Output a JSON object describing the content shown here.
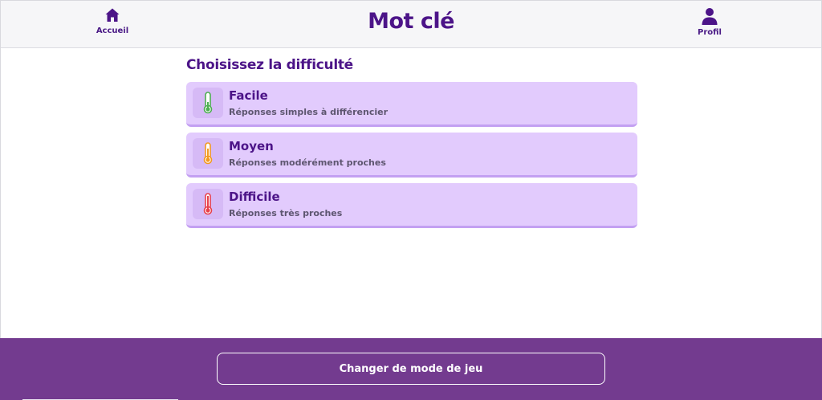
{
  "header": {
    "title": "Mot clé",
    "home_label": "Accueil",
    "profile_label": "Profil"
  },
  "main": {
    "section_title": "Choisissez la difficulté",
    "levels": [
      {
        "name": "Facile",
        "description": "Réponses simples à différencier",
        "icon": "thermometer-low-icon",
        "color": "#4caf50"
      },
      {
        "name": "Moyen",
        "description": "Réponses modérément proches",
        "icon": "thermometer-medium-icon",
        "color": "#f39a1e"
      },
      {
        "name": "Difficile",
        "description": "Réponses très proches",
        "icon": "thermometer-high-icon",
        "color": "#e8404a"
      }
    ]
  },
  "footer": {
    "button_label": "Changer de mode de jeu"
  },
  "colors": {
    "brand": "#4c1488",
    "card": "#e2cbfd",
    "footer": "#733b8f"
  }
}
